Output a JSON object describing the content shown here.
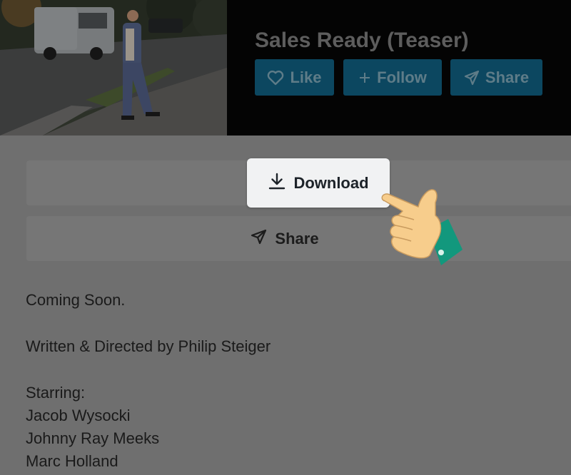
{
  "video": {
    "title": "Sales Ready (Teaser)"
  },
  "header_actions": {
    "like_label": "Like",
    "follow_label": "Follow",
    "share_label": "Share"
  },
  "actions": {
    "download_label": "Download",
    "share_label": "Share"
  },
  "description": {
    "line1": "Coming Soon.",
    "line2": "Written & Directed by Philip Steiger",
    "starring_label": "Starring:",
    "cast": [
      "Jacob Wysocki",
      "Johnny Ray Meeks",
      "Marc Holland"
    ]
  },
  "icons": {
    "like": "heart-icon",
    "follow": "plus-icon",
    "share": "send-icon",
    "download": "download-icon",
    "pointer": "pointing-hand-icon"
  },
  "colors": {
    "overlay_bg": "#6f6f6f",
    "header_bg": "#040404",
    "header_button_bg": "#0c4760",
    "download_button_bg": "#f1f2f3",
    "hand_skin": "#f7cd8c",
    "hand_cuff": "#12987d"
  }
}
